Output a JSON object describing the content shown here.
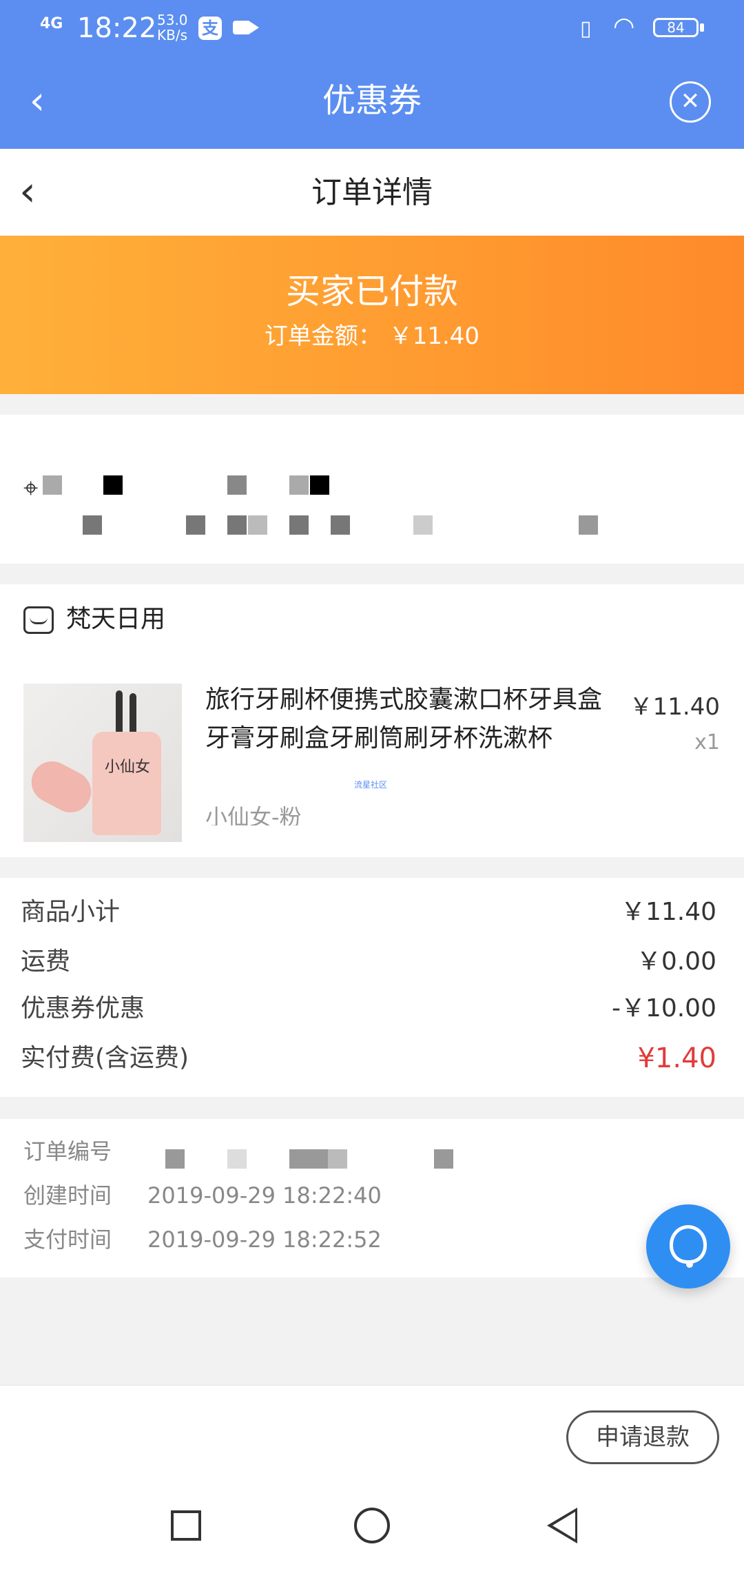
{
  "status_bar": {
    "network": "4G",
    "time": "18:22",
    "speed_value": "53.0",
    "speed_unit": "KB/s",
    "alipay_icon": "alipay-icon",
    "video_icon": "video-icon",
    "battery": "84"
  },
  "app_bar": {
    "title": "优惠券",
    "back_icon": "back-arrow-icon",
    "close_icon": "close-circle-icon"
  },
  "page_header": {
    "title": "订单详情"
  },
  "banner": {
    "status": "买家已付款",
    "amount_label": "订单金额：",
    "amount_value": "￥11.40"
  },
  "shop": {
    "name": "梵天日用",
    "product": {
      "title": "旅行牙刷杯便携式胶囊漱口杯牙具盒牙膏牙刷盒牙刷筒刷牙杯洗漱杯",
      "sku": "小仙女-粉",
      "price": "￥11.40",
      "quantity": "x1",
      "image_text": "小仙女",
      "watermark": "流星社区"
    }
  },
  "summary": [
    {
      "label": "商品小计",
      "value": "￥11.40"
    },
    {
      "label": "运费",
      "value": "￥0.00"
    },
    {
      "label": "优惠券优惠",
      "value": "-￥10.00"
    },
    {
      "label": "实付费(含运费)",
      "value": "¥1.40"
    }
  ],
  "order_info": {
    "order_no_label": "订单编号",
    "created_label": "创建时间",
    "created_value": "2019-09-29 18:22:40",
    "paid_label": "支付时间",
    "paid_value": "2019-09-29 18:22:52"
  },
  "actions": {
    "refund_label": "申请退款"
  },
  "colors": {
    "brand_blue": "#5b8ef0",
    "banner_orange": "#ff9a30",
    "highlight_red": "#e23b3b"
  }
}
